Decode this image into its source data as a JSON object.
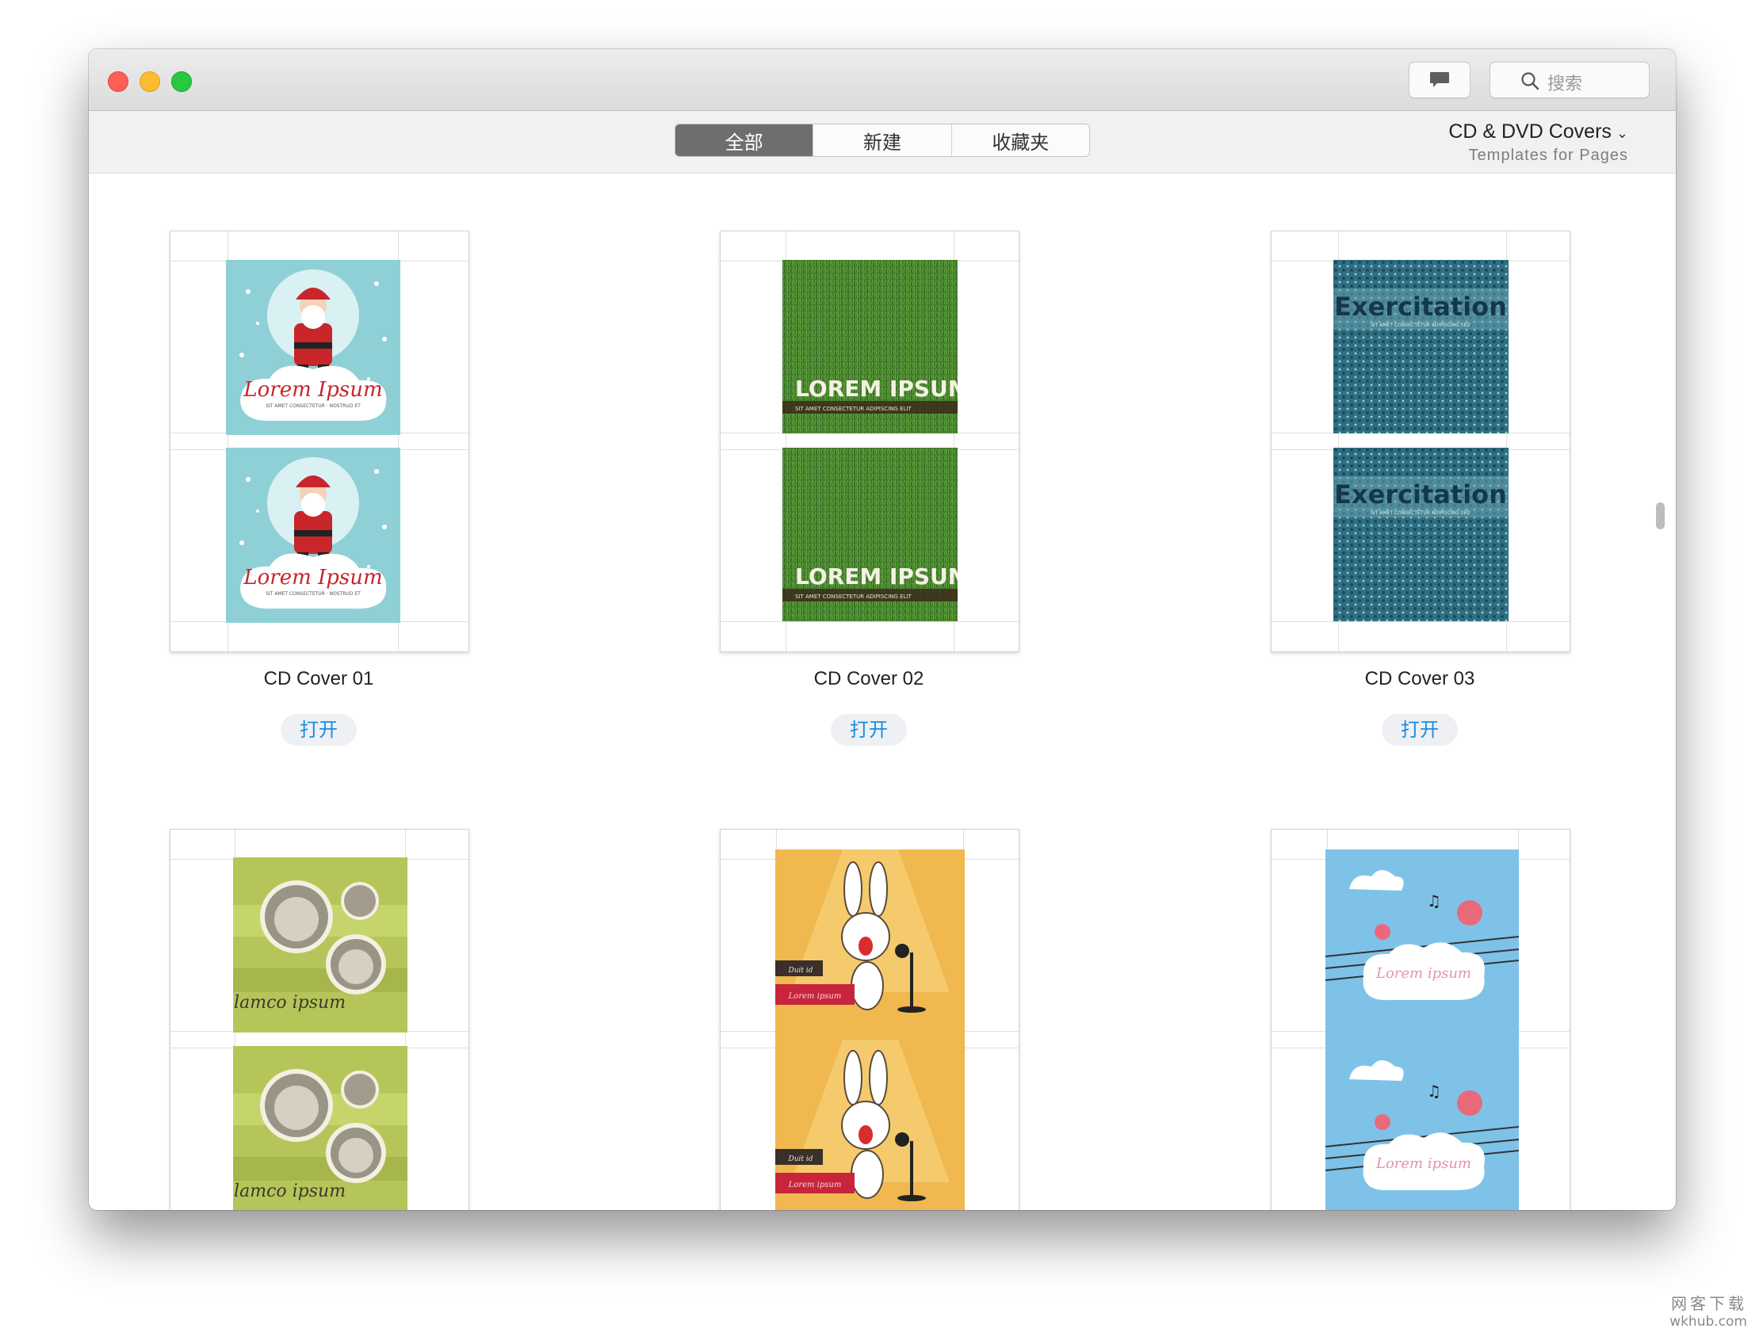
{
  "window": {
    "search_placeholder": "搜索",
    "chat_button_icon": "speech-bubble-icon",
    "search_icon": "magnifier-icon"
  },
  "toolbar": {
    "segments": [
      {
        "label": "全部",
        "active": true
      },
      {
        "label": "新建",
        "active": false
      },
      {
        "label": "收藏夹",
        "active": false
      }
    ],
    "category_title": "CD & DVD Covers",
    "category_subtitle": "Templates for Pages",
    "category_chevron_icon": "chevron-down-icon"
  },
  "templates": [
    {
      "name": "CD Cover 01",
      "open_label": "打开",
      "cover_text": "Lorem Ipsum",
      "cover_subtext": "SIT AMET CONSECTETUR · NOSTRUD ET",
      "theme": "santa",
      "bg": "#8fd0d6"
    },
    {
      "name": "CD Cover 02",
      "open_label": "打开",
      "cover_text": "LOREM IPSUM",
      "cover_subtext": "SIT AMET CONSECTETUR ADIPISCING ELIT",
      "theme": "grass",
      "bg": "#3f7d2a"
    },
    {
      "name": "CD Cover 03",
      "open_label": "打开",
      "cover_text": "Exercitation",
      "cover_subtext": "SIT AMET CONSECTETUR ADIPISCING SED",
      "theme": "dots",
      "bg": "#2d6b7c"
    },
    {
      "cover_text": "Ellamco ipsum",
      "theme": "baby",
      "bg": "#b6c55a"
    },
    {
      "cover_text": "Lorem ipsum",
      "cover_subtext": "Duit id",
      "theme": "bunny",
      "bg": "#f0b84e"
    },
    {
      "cover_text": "Lorem ipsum",
      "theme": "birds",
      "bg": "#7fc2e8"
    }
  ],
  "watermark": {
    "line1": "网客下载",
    "line2": "wkhub.com"
  }
}
